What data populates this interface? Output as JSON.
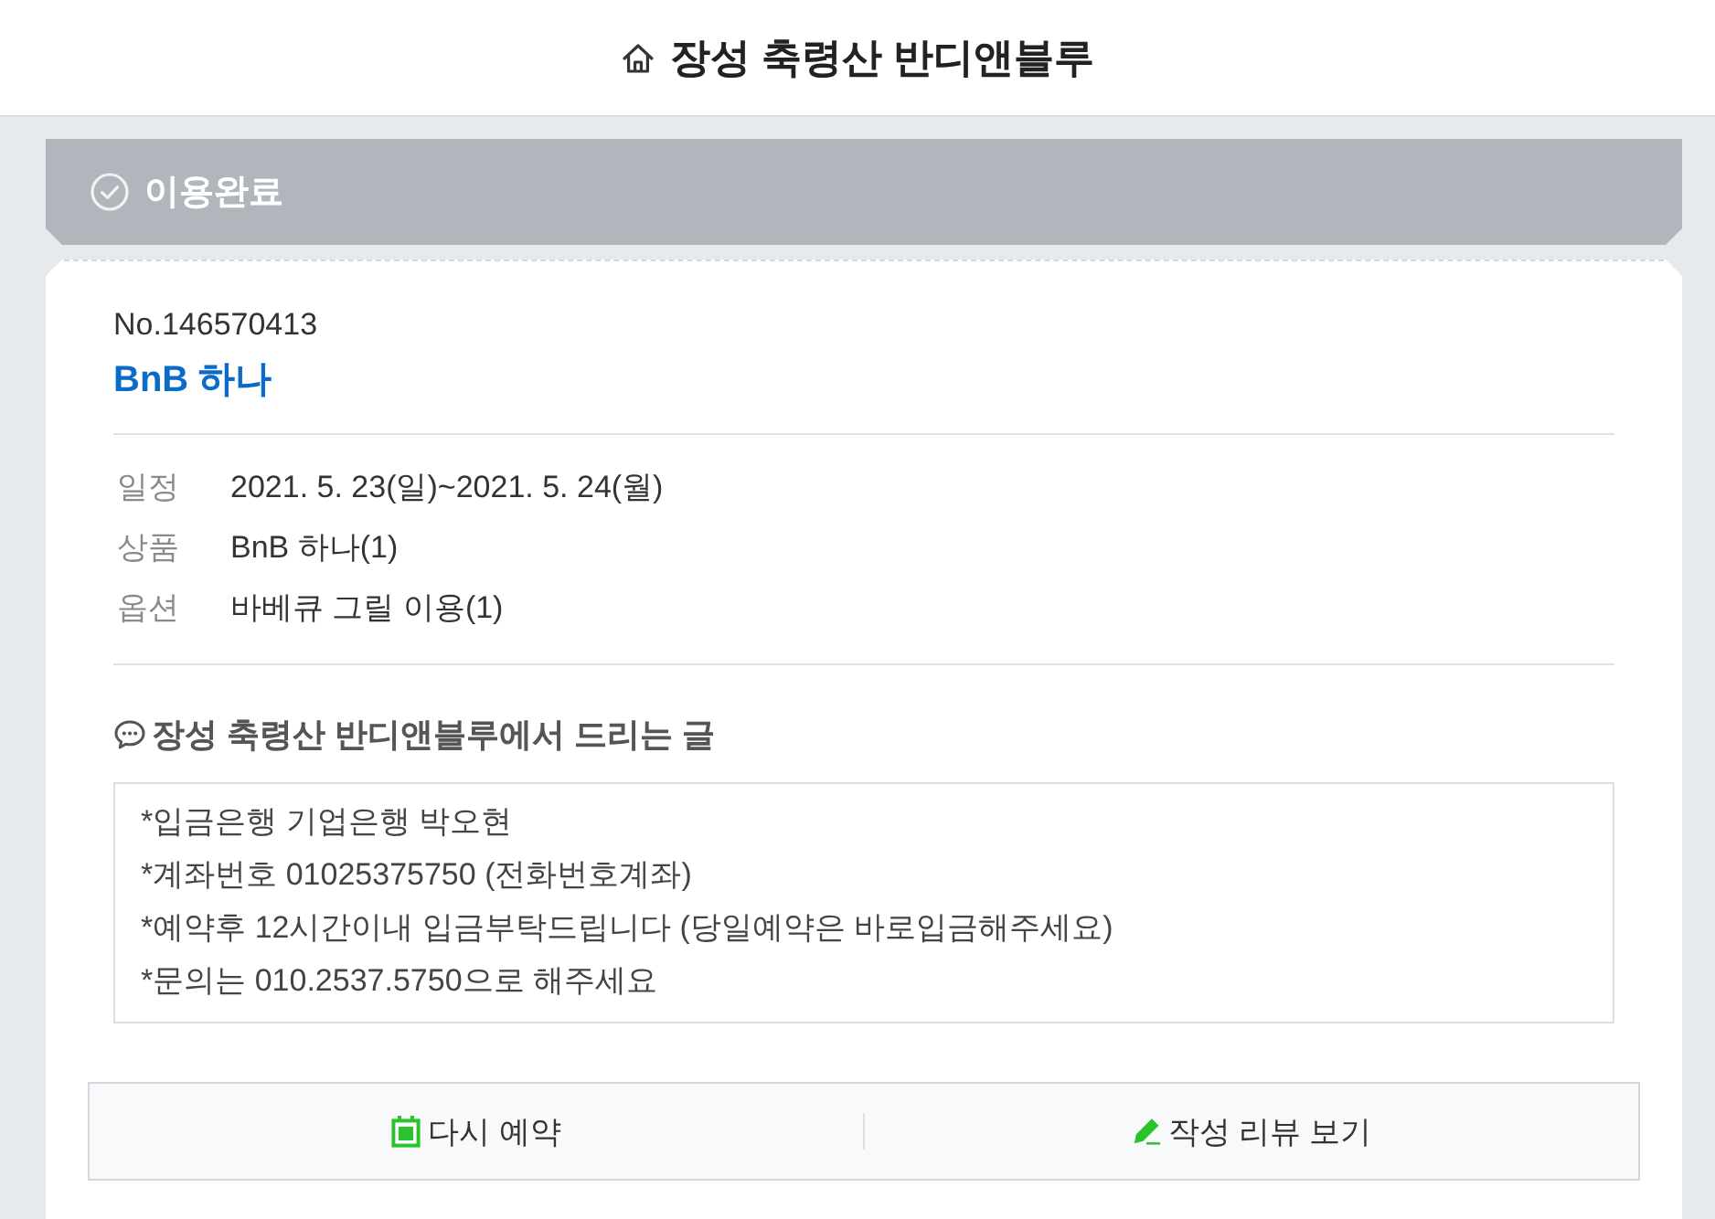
{
  "header": {
    "title": "장성 축령산 반디앤블루"
  },
  "status": {
    "label": "이용완료"
  },
  "booking": {
    "number": "No.146570413",
    "product_name": "BnB 하나"
  },
  "details": [
    {
      "label": "일정",
      "value": "2021. 5. 23(일)~2021. 5. 24(월)"
    },
    {
      "label": "상품",
      "value": "BnB 하나(1)"
    },
    {
      "label": "옵션",
      "value": "바베큐 그릴 이용(1)"
    }
  ],
  "notice": {
    "title": "장성 축령산 반디앤블루에서 드리는 글",
    "lines": [
      "*입금은행 기업은행 박오현",
      "*계좌번호 01025375750 (전화번호계좌)",
      "*예약후 12시간이내 입금부탁드립니다 (당일예약은 바로입금해주세요)",
      "*문의는 010.2537.5750으로 해주세요"
    ]
  },
  "actions": [
    {
      "label": "다시 예약",
      "kind": "rebook"
    },
    {
      "label": "작성 리뷰 보기",
      "kind": "review"
    }
  ]
}
